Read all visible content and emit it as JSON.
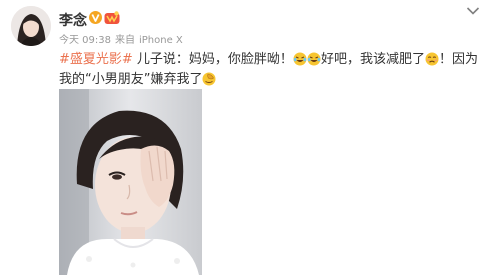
{
  "post": {
    "username": "李念",
    "time": "今天 09:38",
    "source_prefix": "来自",
    "source": "iPhone X",
    "topic": "#盛夏光影#",
    "text_part1": " 儿子说：妈妈，你脸胖呦！",
    "text_part2": "好吧，我该减肥了",
    "text_part3": "！因为我的“小男朋友”嫌弃我了"
  },
  "icons": {
    "verified": "verified-v-badge-icon",
    "level": "member-level-badge-icon",
    "menu": "chevron-down-icon",
    "emoji_laugh_cry": "laugh-cry-emoji-icon",
    "emoji_sad": "sad-face-emoji-icon",
    "emoji_facepalm": "facepalm-emoji-icon"
  },
  "colors": {
    "topic": "#eb7350",
    "meta": "#999999",
    "text": "#333333",
    "verified_badge": "#f5a623"
  }
}
